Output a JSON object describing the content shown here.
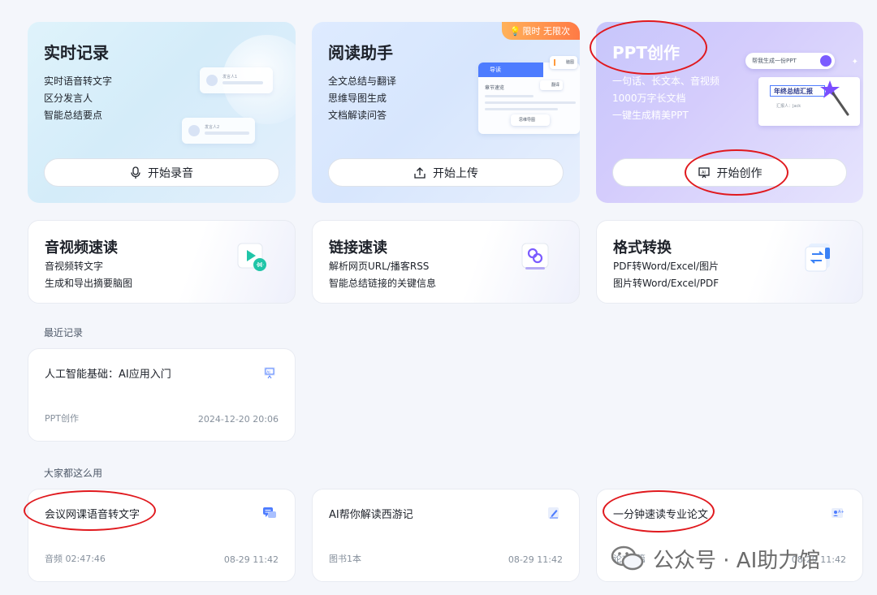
{
  "top_cards": [
    {
      "title": "实时记录",
      "lines": [
        "实时语音转文字",
        "区分发言人",
        "智能总结要点"
      ],
      "action": "开始录音",
      "icon": "microphone-icon"
    },
    {
      "title": "阅读助手",
      "lines": [
        "全文总结与翻译",
        "思维导图生成",
        "文档解读问答"
      ],
      "action": "开始上传",
      "icon": "upload-icon",
      "badge": "限时 无限次"
    },
    {
      "title": "PPT创作",
      "lines": [
        "一句话、长文本、音视频",
        "1000万字长文档",
        "一键生成精美PPT"
      ],
      "action": "开始创作",
      "icon": "presentation-icon"
    }
  ],
  "illustrations": {
    "speaker_a": "发言人1",
    "speaker_b": "发言人2",
    "guide": "导读",
    "chapter": "章节速览",
    "mindmap_chip": "思维导图",
    "mindmap_label": "脑图",
    "translate": "翻译",
    "ppt_prompt": "帮我生成一份PPT",
    "ppt_slide_title": "年终总结汇报",
    "ppt_reporter": "汇报人：Jack"
  },
  "mid_cards": [
    {
      "title": "音视频速读",
      "lines": [
        "音视频转文字",
        "生成和导出摘要脑图"
      ]
    },
    {
      "title": "链接速读",
      "lines": [
        "解析网页URL/播客RSS",
        "智能总结链接的关键信息"
      ]
    },
    {
      "title": "格式转换",
      "lines": [
        "PDF转Word/Excel/图片",
        "图片转Word/Excel/PDF"
      ]
    }
  ],
  "recent": {
    "section_title": "最近记录",
    "items": [
      {
        "name": "人工智能基础：AI应用入门",
        "type": "PPT创作",
        "time": "2024-12-20 20:06"
      }
    ]
  },
  "popular": {
    "section_title": "大家都这么用",
    "items": [
      {
        "name": "会议网课语音转文字",
        "type": "音频 02:47:46",
        "time": "08-29 11:42"
      },
      {
        "name": "AI帮你解读西游记",
        "type": "图书1本",
        "time": "08-29 11:42"
      },
      {
        "name": "一分钟速读专业论文",
        "type": "论文1篇",
        "time": "08-29 11:42"
      }
    ]
  },
  "watermark": "公众号 · AI助力馆",
  "colors": {
    "annotation_circle": "#e0191e",
    "ppt_card": "#c7c6fb",
    "badge": "#ff7a45"
  }
}
